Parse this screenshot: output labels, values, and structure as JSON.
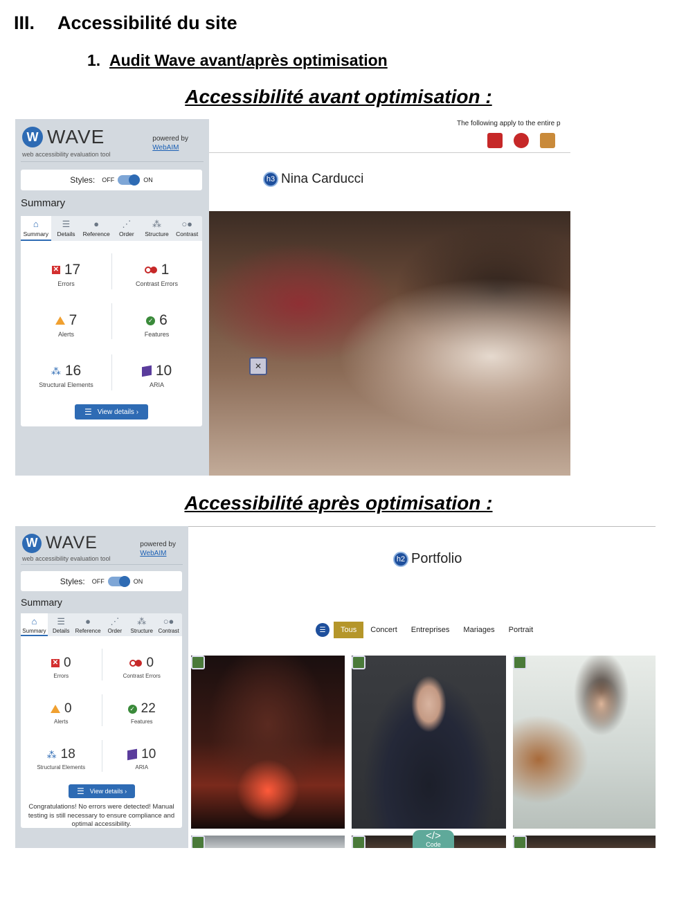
{
  "doc": {
    "section_num": "III.",
    "section_title": "Accessibilité du site",
    "sub_num": "1.",
    "sub_title": "Audit Wave avant/après optimisation",
    "caption_before": "Accessibilité avant optimisation :",
    "caption_after": "Accessibilité après optimisation :"
  },
  "wave_common": {
    "word": "WAVE",
    "logo_letter": "W",
    "tagline": "web accessibility evaluation tool",
    "powered_by": "powered by",
    "webaim": "WebAIM",
    "styles_label": "Styles:",
    "off": "OFF",
    "on": "ON",
    "summary": "Summary",
    "tabs": [
      "Summary",
      "Details",
      "Reference",
      "Order",
      "Structure",
      "Contrast"
    ],
    "labels": {
      "errors": "Errors",
      "contrast": "Contrast Errors",
      "alerts": "Alerts",
      "features": "Features",
      "structural": "Structural Elements",
      "aria": "ARIA"
    },
    "view_details": "View details ›"
  },
  "before": {
    "errors": "17",
    "contrast": "1",
    "alerts": "7",
    "features": "6",
    "structural": "16",
    "aria": "10",
    "notice": "The following apply to the entire p",
    "heading_level": "h3",
    "heading_text": "Nina Carducci"
  },
  "after": {
    "errors": "0",
    "contrast": "0",
    "alerts": "0",
    "features": "22",
    "structural": "18",
    "aria": "10",
    "congrats": "Congratulations! No errors were detected! Manual testing is still necessary to ensure compliance and optimal accessibility.",
    "heading_level": "h2",
    "heading_text": "Portfolio",
    "filters": [
      "Tous",
      "Concert",
      "Entreprises",
      "Mariages",
      "Portrait"
    ],
    "code_glyph": "</>",
    "code_label": "Code"
  },
  "colors": {
    "wave_blue": "#2e6bb4",
    "error_red": "#d32f2f",
    "alert_orange": "#f0a030",
    "feature_green": "#3a8a3a",
    "aria_purple": "#5a3c9c",
    "filter_active": "#b5962a"
  },
  "icons": [
    "home-icon",
    "list-icon",
    "info-icon",
    "order-icon",
    "structure-icon",
    "contrast-icon",
    "error-icon",
    "alert-icon",
    "feature-icon",
    "aria-icon"
  ]
}
